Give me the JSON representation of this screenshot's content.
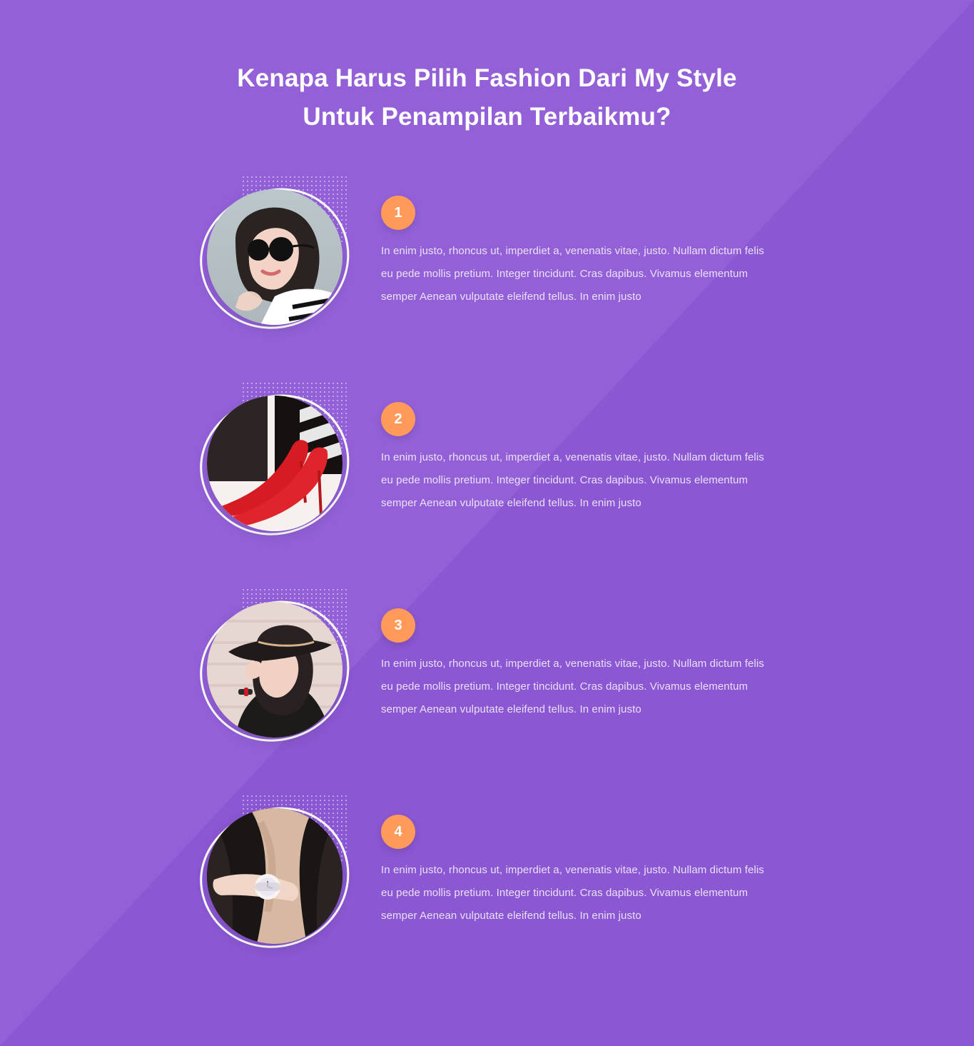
{
  "section": {
    "title_line_1": "Kenapa Harus Pilih Fashion Dari My Style",
    "title_line_2": "Untuk Penampilan Terbaikmu?"
  },
  "features": [
    {
      "number": "1",
      "description": "In enim justo, rhoncus ut, imperdiet a, venenatis vitae, justo. Nullam dictum felis eu pede mollis pretium. Integer tincidunt. Cras dapibus. Vivamus elementum semper Aenean vulputate eleifend tellus. In enim justo"
    },
    {
      "number": "2",
      "description": "In enim justo, rhoncus ut, imperdiet a, venenatis vitae, justo. Nullam dictum felis eu pede mollis pretium. Integer tincidunt. Cras dapibus. Vivamus elementum semper Aenean vulputate eleifend tellus. In enim justo"
    },
    {
      "number": "3",
      "description": "In enim justo, rhoncus ut, imperdiet a, venenatis vitae, justo. Nullam dictum felis eu pede mollis pretium. Integer tincidunt. Cras dapibus. Vivamus elementum semper Aenean vulputate eleifend tellus. In enim justo"
    },
    {
      "number": "4",
      "description": "In enim justo, rhoncus ut, imperdiet a, venenatis vitae, justo. Nullam dictum felis eu pede mollis pretium. Integer tincidunt. Cras dapibus. Vivamus elementum semper Aenean vulputate eleifend tellus. In enim justo"
    }
  ],
  "colors": {
    "background": "#9360d8",
    "background_diagonal": "#8b57d2",
    "badge": "#ff9a5a",
    "text": "#ffffff"
  },
  "icons": {
    "photo_1": "woman-sunglasses-photo",
    "photo_2": "red-heels-photo",
    "photo_3": "woman-hat-photo",
    "photo_4": "wrist-watch-photo"
  }
}
